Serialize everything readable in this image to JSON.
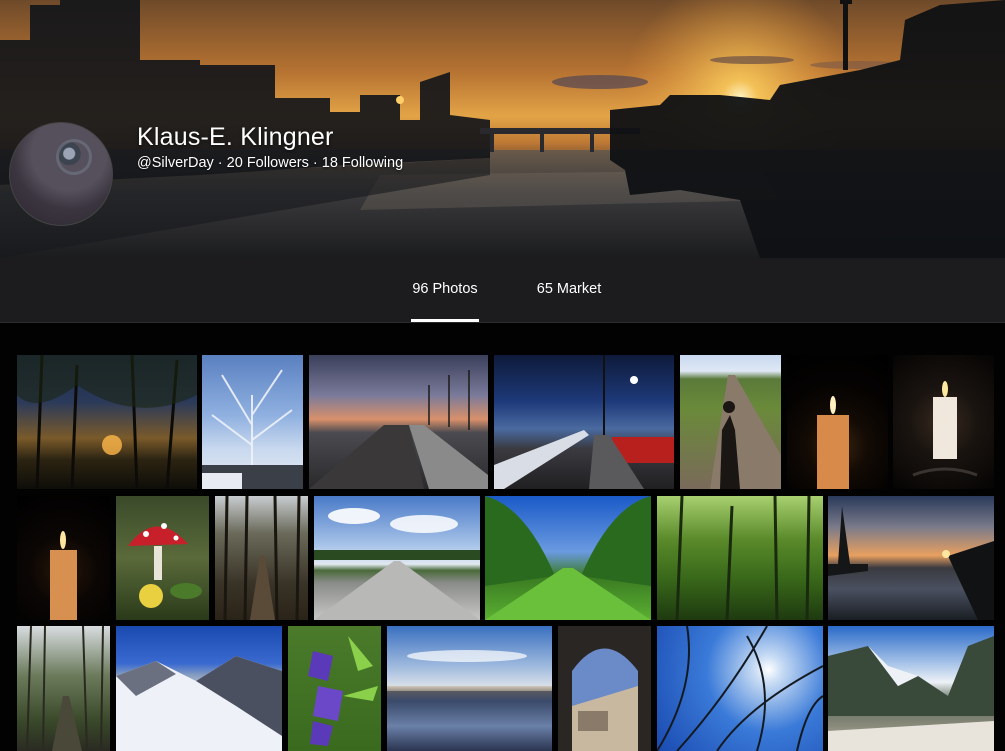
{
  "profile": {
    "name": "Klaus-E. Klingner",
    "handle": "@SilverDay",
    "separator": " · ",
    "followers": "20 Followers",
    "following": "18 Following"
  },
  "tabs": [
    {
      "label": "96 Photos",
      "active": true
    },
    {
      "label": "65 Market",
      "active": false
    }
  ],
  "photos": [
    {
      "subject": "forest-sunset"
    },
    {
      "subject": "frosty-tree"
    },
    {
      "subject": "railway-platform-dusk"
    },
    {
      "subject": "train-station-snow"
    },
    {
      "subject": "shadow-on-path"
    },
    {
      "subject": "candle"
    },
    {
      "subject": "candle-holder"
    },
    {
      "subject": "candle"
    },
    {
      "subject": "mushroom"
    },
    {
      "subject": "forest-path"
    },
    {
      "subject": "avenue-road"
    },
    {
      "subject": "tree-avenue"
    },
    {
      "subject": "green-forest"
    },
    {
      "subject": "river-skyline"
    },
    {
      "subject": "bare-forest-path"
    },
    {
      "subject": "snowy-mountains"
    },
    {
      "subject": "purple-flowers"
    },
    {
      "subject": "lake-reflection"
    },
    {
      "subject": "stone-arch"
    },
    {
      "subject": "branches-sun"
    },
    {
      "subject": "mountain-river"
    }
  ],
  "colors": {
    "tab_bar": "#1c1c1e",
    "background": "#000000",
    "accent": "#ffffff"
  }
}
